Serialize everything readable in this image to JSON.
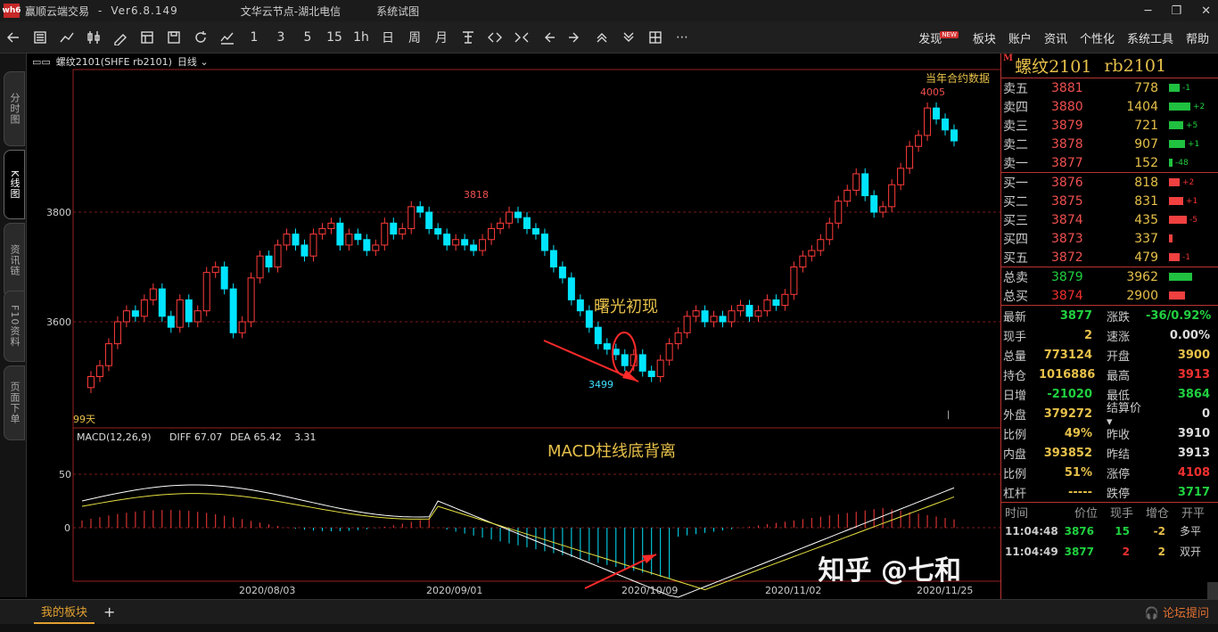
{
  "app": {
    "logo": "wh6",
    "name": "赢顺云端交易",
    "sep": "-",
    "version": "Ver6.8.149",
    "cloud_node": "文华云节点-湖北电信",
    "broadcast": "系统试图"
  },
  "toolbar": {
    "periods": [
      "1",
      "3",
      "5",
      "15",
      "1h",
      "日",
      "周",
      "月"
    ],
    "menu": [
      "发现",
      "板块",
      "账户",
      "资讯",
      "个性化",
      "系统工具",
      "帮助"
    ],
    "new_badge": "NEW"
  },
  "left_tabs": [
    "分时图",
    "K线图",
    "资讯链",
    "F10资料",
    "页面下单"
  ],
  "chart": {
    "symbol": "螺纹2101(SHFE rb2101)",
    "period": "日线",
    "contract_note": "当年合约数据",
    "days": "99天",
    "macd_label": "MACD(12,26,9)",
    "diff": "DIFF 67.07",
    "dea": "DEA 65.42",
    "macd": "3.31",
    "annotation1": "曙光初现",
    "annotation2": "MACD柱线底背离",
    "high_label": "4005",
    "mid_label": "3818",
    "low_label": "3499",
    "price_axis": [
      "3800",
      "3600"
    ],
    "macd_axis": [
      "50",
      "0"
    ],
    "dates": [
      "2020/08/03",
      "2020/09/01",
      "2020/10/09",
      "2020/11/02",
      "2020/11/25"
    ],
    "colors": {
      "up": "#ff3b3b",
      "down": "#00e5ff",
      "grid": "#7a1a1a",
      "annot": "#e6c04a"
    }
  },
  "quote": {
    "title": "螺纹2101",
    "code": "rb2101",
    "m": "M",
    "asks": [
      {
        "label": "卖五",
        "price": "3881",
        "vol": "778",
        "delta": "-1"
      },
      {
        "label": "卖四",
        "price": "3880",
        "vol": "1404",
        "delta": "+2"
      },
      {
        "label": "卖三",
        "price": "3879",
        "vol": "721",
        "delta": "+5"
      },
      {
        "label": "卖二",
        "price": "3878",
        "vol": "907",
        "delta": "+1"
      },
      {
        "label": "卖一",
        "price": "3877",
        "vol": "152",
        "delta": "-48"
      }
    ],
    "bids": [
      {
        "label": "买一",
        "price": "3876",
        "vol": "818",
        "delta": "+2"
      },
      {
        "label": "买二",
        "price": "3875",
        "vol": "831",
        "delta": "+1"
      },
      {
        "label": "买三",
        "price": "3874",
        "vol": "435",
        "delta": "-5"
      },
      {
        "label": "买四",
        "price": "3873",
        "vol": "337",
        "delta": ""
      },
      {
        "label": "买五",
        "price": "3872",
        "vol": "479",
        "delta": "-1"
      }
    ],
    "totals": [
      {
        "label": "总卖",
        "price": "3879",
        "vol": "3962"
      },
      {
        "label": "总买",
        "price": "3874",
        "vol": "2900"
      }
    ],
    "info": [
      [
        "最新",
        "3877",
        "涨跌",
        "-36/0.92%"
      ],
      [
        "现手",
        "2",
        "速涨",
        "0.00%"
      ],
      [
        "总量",
        "773124",
        "开盘",
        "3900"
      ],
      [
        "持仓",
        "1016886",
        "最高",
        "3913"
      ],
      [
        "日增",
        "-21020",
        "最低",
        "3864"
      ],
      [
        "外盘",
        "379272",
        "结算价",
        "0"
      ],
      [
        "比例",
        "49%",
        "昨收",
        "3910"
      ],
      [
        "内盘",
        "393852",
        "昨结",
        "3913"
      ],
      [
        "比例",
        "51%",
        "涨停",
        "4108"
      ],
      [
        "杠杆",
        "-----",
        "跌停",
        "3717"
      ]
    ],
    "tick_head": [
      "时间",
      "价位",
      "现手",
      "增仓",
      "开平"
    ],
    "ticks": [
      [
        "11:04:48",
        "3876",
        "15",
        "-2",
        "多平"
      ],
      [
        "11:04:49",
        "3877",
        "2",
        "2",
        "双开"
      ]
    ]
  },
  "bottom": {
    "tab": "我的板块",
    "add": "+",
    "forum": "论坛提问"
  },
  "watermark": "知乎 @七和"
}
